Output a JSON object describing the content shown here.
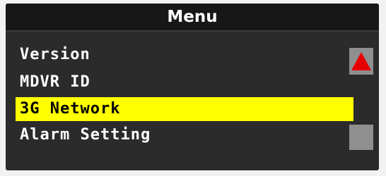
{
  "menu": {
    "title": "Menu",
    "items": [
      {
        "label": "Version"
      },
      {
        "label": "MDVR ID"
      },
      {
        "label": "3G Network",
        "selected": true
      },
      {
        "label": "Alarm Setting"
      }
    ]
  },
  "scrollbar": {
    "up_icon": "triangle-up-icon",
    "up_arrow_color": "#e60000",
    "button_color": "#8f8f8f"
  },
  "colors": {
    "highlight": "#ffff00",
    "background": "#2b2b2b",
    "header": "#171717",
    "text": "#ffffff"
  }
}
